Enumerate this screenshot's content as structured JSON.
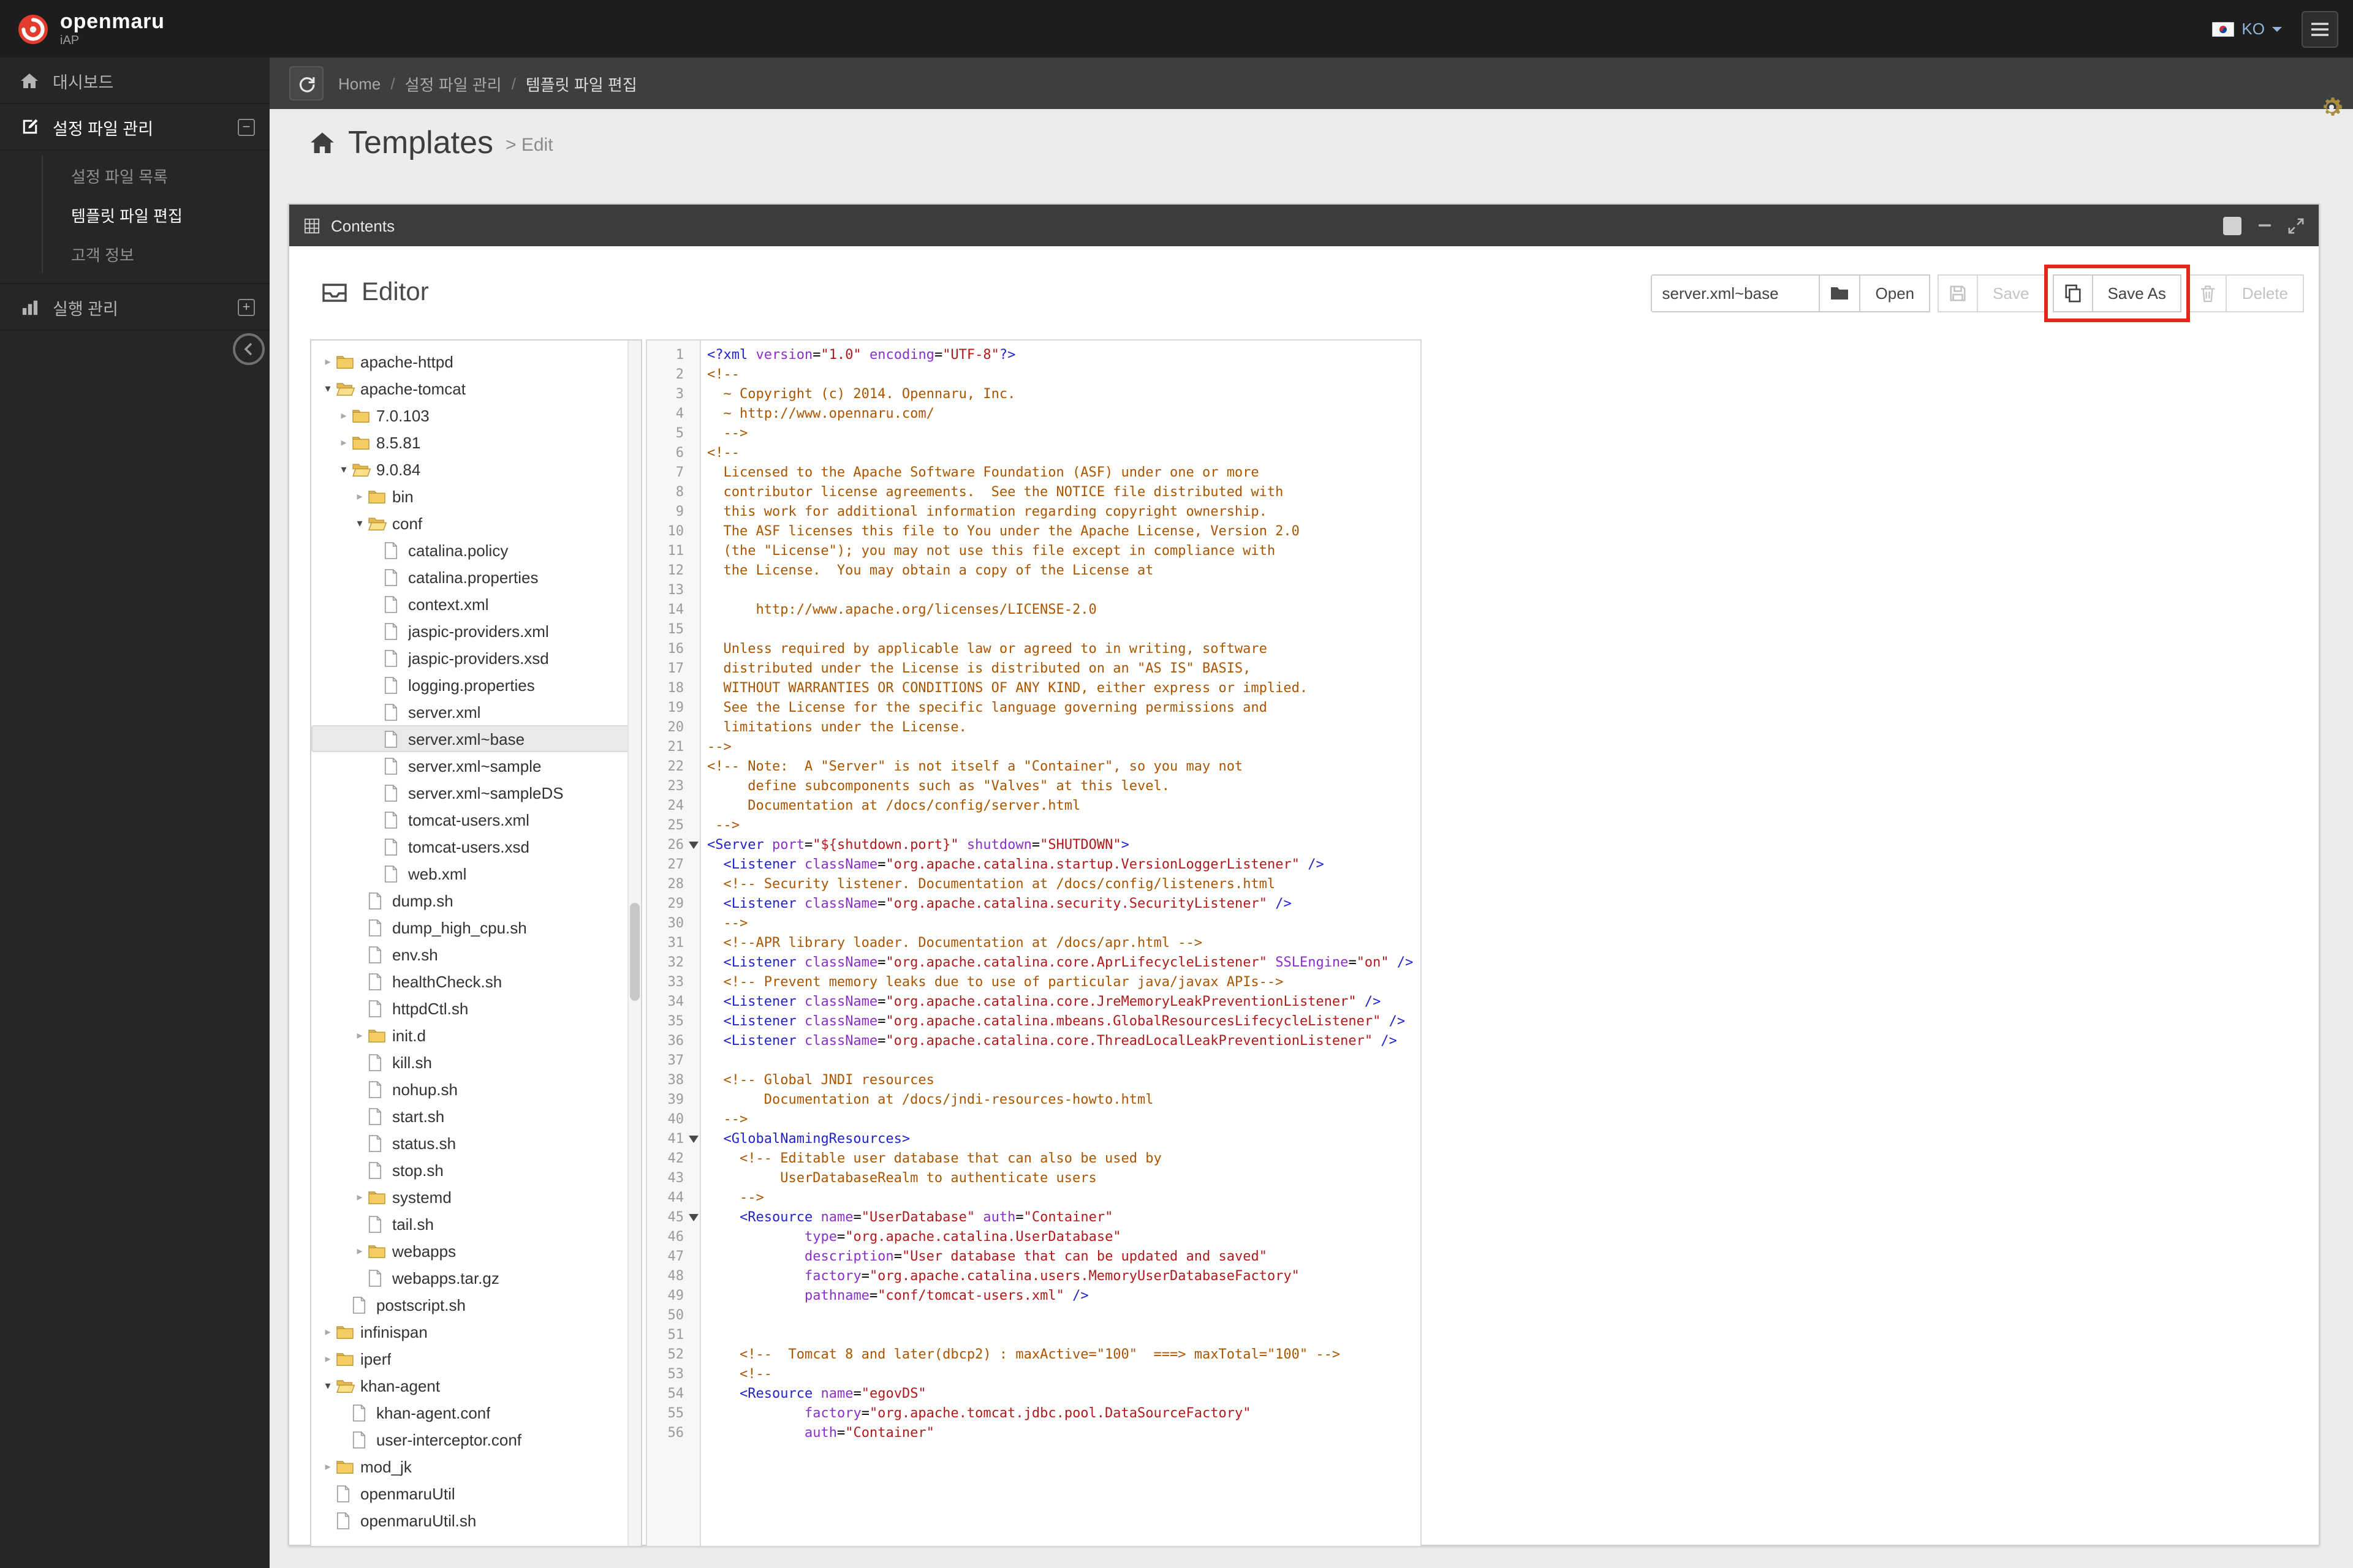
{
  "colors": {
    "brand_red": "#e23c2e",
    "annotation_red": "#e8251a",
    "selected_row_bg": "#e9e9e9",
    "syntax_tag": "#2222cc",
    "syntax_attr": "#8b2fc9",
    "syntax_string": "#b11a1a",
    "syntax_comment": "#aa5500"
  },
  "icons": {
    "logo": "red-spiral-circle",
    "language_flag": "korea-taegukgi",
    "language_caret": "chevron-down",
    "menu_toggle": "hamburger",
    "breadcrumb_refresh": "circular-arrow",
    "settings": "gear",
    "sidebar_dashboard": "home",
    "sidebar_config": "pencil-square",
    "sidebar_run": "bar-chart",
    "section_collapse": "minus-box",
    "section_expand": "plus-box",
    "sidebar_collapse": "circle-chevron-left",
    "panel": "grid",
    "panel_minimize": "minus",
    "panel_fullscreen": "diagonal-arrows",
    "editor": "inbox",
    "browse": "folder",
    "save": "floppy-disk",
    "save_as": "copy-pages",
    "delete": "trash-can",
    "tree_closed": "folder",
    "tree_open": "open-folder",
    "tree_file": "page",
    "code_fold": "down-triangle"
  },
  "topbar": {
    "logo_text": "openmaru",
    "logo_sub": "iAP",
    "language": "KO"
  },
  "sidebar": {
    "items": [
      {
        "label": "대시보드"
      },
      {
        "label": "설정 파일 관리",
        "expanded": true,
        "children": [
          {
            "label": "설정 파일 목록",
            "active": false
          },
          {
            "label": "템플릿 파일 편집",
            "active": true
          },
          {
            "label": "고객 정보",
            "active": false
          }
        ]
      },
      {
        "label": "실행 관리",
        "expanded": false
      }
    ]
  },
  "breadcrumb": {
    "items": [
      "Home",
      "설정 파일 관리",
      "템플릿 파일 편집"
    ]
  },
  "page": {
    "title": "Templates",
    "subtitle": "> Edit"
  },
  "contents_panel": {
    "title": "Contents"
  },
  "editor": {
    "heading": "Editor",
    "filename_value": "server.xml~base",
    "buttons": {
      "open": "Open",
      "save": "Save",
      "save_as": "Save As",
      "delete": "Delete"
    }
  },
  "file_tree": [
    {
      "label": "apache-httpd",
      "depth": 0,
      "type": "folder",
      "arrow": "collapsed"
    },
    {
      "label": "apache-tomcat",
      "depth": 0,
      "type": "folder-open",
      "arrow": "expanded"
    },
    {
      "label": "7.0.103",
      "depth": 1,
      "type": "folder",
      "arrow": "collapsed"
    },
    {
      "label": "8.5.81",
      "depth": 1,
      "type": "folder",
      "arrow": "collapsed"
    },
    {
      "label": "9.0.84",
      "depth": 1,
      "type": "folder-open",
      "arrow": "expanded"
    },
    {
      "label": "bin",
      "depth": 2,
      "type": "folder",
      "arrow": "collapsed"
    },
    {
      "label": "conf",
      "depth": 2,
      "type": "folder-open",
      "arrow": "expanded"
    },
    {
      "label": "catalina.policy",
      "depth": 3,
      "type": "file"
    },
    {
      "label": "catalina.properties",
      "depth": 3,
      "type": "file"
    },
    {
      "label": "context.xml",
      "depth": 3,
      "type": "file"
    },
    {
      "label": "jaspic-providers.xml",
      "depth": 3,
      "type": "file"
    },
    {
      "label": "jaspic-providers.xsd",
      "depth": 3,
      "type": "file"
    },
    {
      "label": "logging.properties",
      "depth": 3,
      "type": "file"
    },
    {
      "label": "server.xml",
      "depth": 3,
      "type": "file"
    },
    {
      "label": "server.xml~base",
      "depth": 3,
      "type": "file",
      "selected": true
    },
    {
      "label": "server.xml~sample",
      "depth": 3,
      "type": "file"
    },
    {
      "label": "server.xml~sampleDS",
      "depth": 3,
      "type": "file"
    },
    {
      "label": "tomcat-users.xml",
      "depth": 3,
      "type": "file"
    },
    {
      "label": "tomcat-users.xsd",
      "depth": 3,
      "type": "file"
    },
    {
      "label": "web.xml",
      "depth": 3,
      "type": "file"
    },
    {
      "label": "dump.sh",
      "depth": 2,
      "type": "file"
    },
    {
      "label": "dump_high_cpu.sh",
      "depth": 2,
      "type": "file"
    },
    {
      "label": "env.sh",
      "depth": 2,
      "type": "file"
    },
    {
      "label": "healthCheck.sh",
      "depth": 2,
      "type": "file"
    },
    {
      "label": "httpdCtl.sh",
      "depth": 2,
      "type": "file"
    },
    {
      "label": "init.d",
      "depth": 2,
      "type": "folder",
      "arrow": "collapsed"
    },
    {
      "label": "kill.sh",
      "depth": 2,
      "type": "file"
    },
    {
      "label": "nohup.sh",
      "depth": 2,
      "type": "file"
    },
    {
      "label": "start.sh",
      "depth": 2,
      "type": "file"
    },
    {
      "label": "status.sh",
      "depth": 2,
      "type": "file"
    },
    {
      "label": "stop.sh",
      "depth": 2,
      "type": "file"
    },
    {
      "label": "systemd",
      "depth": 2,
      "type": "folder",
      "arrow": "collapsed"
    },
    {
      "label": "tail.sh",
      "depth": 2,
      "type": "file"
    },
    {
      "label": "webapps",
      "depth": 2,
      "type": "folder",
      "arrow": "collapsed"
    },
    {
      "label": "webapps.tar.gz",
      "depth": 2,
      "type": "file"
    },
    {
      "label": "postscript.sh",
      "depth": 1,
      "type": "file"
    },
    {
      "label": "infinispan",
      "depth": 0,
      "type": "folder",
      "arrow": "collapsed"
    },
    {
      "label": "iperf",
      "depth": 0,
      "type": "folder",
      "arrow": "collapsed"
    },
    {
      "label": "khan-agent",
      "depth": 0,
      "type": "folder-open",
      "arrow": "expanded"
    },
    {
      "label": "khan-agent.conf",
      "depth": 1,
      "type": "file"
    },
    {
      "label": "user-interceptor.conf",
      "depth": 1,
      "type": "file"
    },
    {
      "label": "mod_jk",
      "depth": 0,
      "type": "folder",
      "arrow": "collapsed"
    },
    {
      "label": "openmaruUtil",
      "depth": 0,
      "type": "file"
    },
    {
      "label": "openmaruUtil.sh",
      "depth": 0,
      "type": "file"
    }
  ],
  "code": {
    "language": "xml",
    "fold_lines": [
      26,
      41,
      45
    ],
    "lines": [
      "<?xml version=\"1.0\" encoding=\"UTF-8\"?>",
      "<!--",
      "  ~ Copyright (c) 2014. Opennaru, Inc.",
      "  ~ http://www.opennaru.com/",
      "  -->",
      "<!--",
      "  Licensed to the Apache Software Foundation (ASF) under one or more",
      "  contributor license agreements.  See the NOTICE file distributed with",
      "  this work for additional information regarding copyright ownership.",
      "  The ASF licenses this file to You under the Apache License, Version 2.0",
      "  (the \"License\"); you may not use this file except in compliance with",
      "  the License.  You may obtain a copy of the License at",
      "",
      "      http://www.apache.org/licenses/LICENSE-2.0",
      "",
      "  Unless required by applicable law or agreed to in writing, software",
      "  distributed under the License is distributed on an \"AS IS\" BASIS,",
      "  WITHOUT WARRANTIES OR CONDITIONS OF ANY KIND, either express or implied.",
      "  See the License for the specific language governing permissions and",
      "  limitations under the License.",
      "-->",
      "<!-- Note:  A \"Server\" is not itself a \"Container\", so you may not",
      "     define subcomponents such as \"Valves\" at this level.",
      "     Documentation at /docs/config/server.html",
      " -->",
      "<Server port=\"${shutdown.port}\" shutdown=\"SHUTDOWN\">",
      "  <Listener className=\"org.apache.catalina.startup.VersionLoggerListener\" />",
      "  <!-- Security listener. Documentation at /docs/config/listeners.html",
      "  <Listener className=\"org.apache.catalina.security.SecurityListener\" />",
      "  -->",
      "  <!--APR library loader. Documentation at /docs/apr.html -->",
      "  <Listener className=\"org.apache.catalina.core.AprLifecycleListener\" SSLEngine=\"on\" />",
      "  <!-- Prevent memory leaks due to use of particular java/javax APIs-->",
      "  <Listener className=\"org.apache.catalina.core.JreMemoryLeakPreventionListener\" />",
      "  <Listener className=\"org.apache.catalina.mbeans.GlobalResourcesLifecycleListener\" />",
      "  <Listener className=\"org.apache.catalina.core.ThreadLocalLeakPreventionListener\" />",
      "",
      "  <!-- Global JNDI resources",
      "       Documentation at /docs/jndi-resources-howto.html",
      "  -->",
      "  <GlobalNamingResources>",
      "    <!-- Editable user database that can also be used by",
      "         UserDatabaseRealm to authenticate users",
      "    -->",
      "    <Resource name=\"UserDatabase\" auth=\"Container\"",
      "            type=\"org.apache.catalina.UserDatabase\"",
      "            description=\"User database that can be updated and saved\"",
      "            factory=\"org.apache.catalina.users.MemoryUserDatabaseFactory\"",
      "            pathname=\"conf/tomcat-users.xml\" />",
      "",
      "",
      "    <!--  Tomcat 8 and later(dbcp2) : maxActive=\"100\"  ===> maxTotal=\"100\" -->",
      "    <!--",
      "    <Resource name=\"egovDS\"",
      "            factory=\"org.apache.tomcat.jdbc.pool.DataSourceFactory\"",
      "            auth=\"Container\""
    ]
  }
}
